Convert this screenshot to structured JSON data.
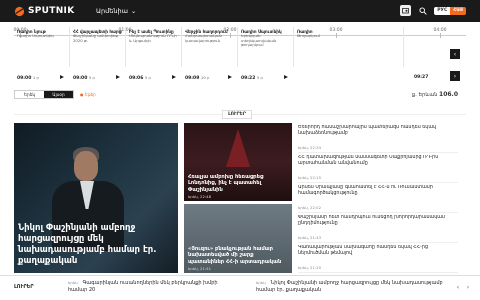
{
  "header": {
    "logo_text": "SPUTNIK",
    "lang_label": "Արմենիա",
    "lang_ru": "РУС",
    "lang_am": "ՀԱՅ"
  },
  "timeline": {
    "times": [
      "00:00",
      "01:00",
      "02:00",
      "03:00",
      "04:00"
    ],
    "cards": [
      {
        "title": "Ռադիո նյութ",
        "sub": "Ռադիո Սպուտնիկ",
        "time": "09:00",
        "dur": "1 ր"
      },
      {
        "title": "ՀՀ վարչապետի հարցազրույց",
        "sub": "Փաշինյանը ամփոփեց 2020 թ․",
        "time": "09:00",
        "dur": "5 ր"
      },
      {
        "title": "Ինչ է ասել Պուտինը",
        "sub": "Մեկնաբանություն ՌԴ-ի և Արցախի",
        "time": "09:06",
        "dur": "5 ր"
      },
      {
        "title": "Վերջին հաղորդում",
        "sub": "Հանրապետական կառավարություն",
        "time": "09:09",
        "dur": "10 ր"
      },
      {
        "title": "Ռադիո Սպուտնիկ",
        "sub": "Երեկոյան տեղեկատվական թողարկում",
        "time": "09:22",
        "dur": "5 ր"
      },
      {
        "title": "Ռադիո",
        "sub": "Թողարկում",
        "time": "09:27",
        "dur": ""
      }
    ]
  },
  "player": {
    "toggle_left": "Երեկ",
    "toggle_right": "Այսօր",
    "live_label": "● Եթեր",
    "freq_label": "ք. Երևան",
    "freq_value": "106.0"
  },
  "section_title": "ԼՈՒՐԵՐ",
  "main_story": {
    "caption": "Նիկոլ Փաշինյանի ամբողջ հարցազրույցը մեկ նախադասությամբ համար էր. քաղաքական"
  },
  "mid_stories": [
    {
      "caption": "Հռաչյա ամբոխը հեռացրեց Լոնդոնից, ինչ է պատահել Փաշինյանին",
      "date": "երեկ, 22:48"
    },
    {
      "caption": "«Յուզու» բնակչության համար նախատեսված մի շարք պատանիներ ՀՀ-ի արտադրական",
      "date": "երեկ, 21:51"
    }
  ],
  "news": [
    {
      "text": "Եռերորդ համաշխարհային պատերազմ հանդես եկավ նախաձեռնությամբ",
      "date": "երեկ, 22:34"
    },
    {
      "text": "ՀՀ դատախազության մասնագետի Սաքրոյանից ՌԴ-ին արտահանման անվանումը",
      "date": "երեկ, 22:15"
    },
    {
      "text": "Արմեն Սրապյանը գնահատել է ՀՀ-ն ու Ռուսաստանի համագործակցությունը",
      "date": "երեկ, 22:02"
    },
    {
      "text": "Փաշինյանի հետ հանդիպում ունեցող խորհրդարանական ընդդիմությունը",
      "date": "երեկ, 21:43"
    },
    {
      "text": "Կառավարության նախագահը հանդես եկավ ՀՀ-ից ներմուծման թեմայով",
      "date": "երեկ, 21:20"
    }
  ],
  "bottom": {
    "label": "ԼՈՒՐԵՐ",
    "item1_date": "երեկ",
    "item1_text": "Գագարինյան ուսանողներին մեկ բերկրանքի խմբի համար 20",
    "item2_date": "երեկ",
    "item2_text": "Նիկոլ Փաշինյանի ամբողջ հարցազրույցը մեկ նախադասությամբ համար էր. քաղաքական"
  },
  "colors": {
    "accent": "#f26b1d",
    "topbar": "#1a1a1a"
  }
}
